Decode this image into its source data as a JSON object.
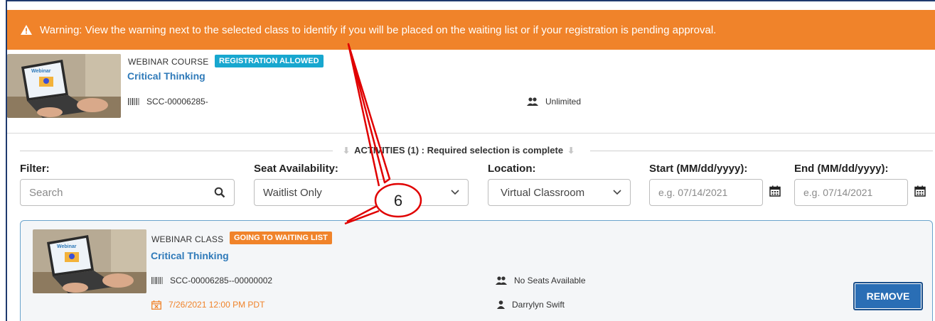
{
  "warning": {
    "text": "Warning: View the warning next to the selected class to identify if you will be placed on the waiting list or if your registration is pending approval."
  },
  "course": {
    "type_label": "WEBINAR COURSE",
    "badge": "REGISTRATION ALLOWED",
    "title": "Critical Thinking",
    "code": "SCC-00006285-",
    "seats": "Unlimited",
    "thumbnail_caption": "Webinar"
  },
  "activities": {
    "label": "ACTIVITIES (1) : Required selection is complete"
  },
  "filters": {
    "filter_label": "Filter:",
    "search_placeholder": "Search",
    "seat_label": "Seat Availability:",
    "seat_value": "Waitlist Only",
    "location_label": "Location:",
    "location_value": "Virtual Classroom",
    "start_label": "Start (MM/dd/yyyy):",
    "start_placeholder": "e.g. 07/14/2021",
    "end_label": "End (MM/dd/yyyy):",
    "end_placeholder": "e.g. 07/14/2021"
  },
  "class": {
    "type_label": "WEBINAR CLASS",
    "badge": "GOING TO WAITING LIST",
    "title": "Critical Thinking",
    "code": "SCC-00006285--00000002",
    "date": "7/26/2021 12:00 PM PDT",
    "seats": "No Seats Available",
    "instructor": "Darrylyn Swift",
    "remove_label": "REMOVE",
    "thumbnail_caption": "Webinar"
  },
  "annotation": {
    "callout_number": "6"
  },
  "colors": {
    "warning_bg": "#f0832a",
    "link": "#2f7ab9",
    "badge_blue": "#18a7cf",
    "button": "#2a6eb5",
    "callout": "#e00000"
  }
}
